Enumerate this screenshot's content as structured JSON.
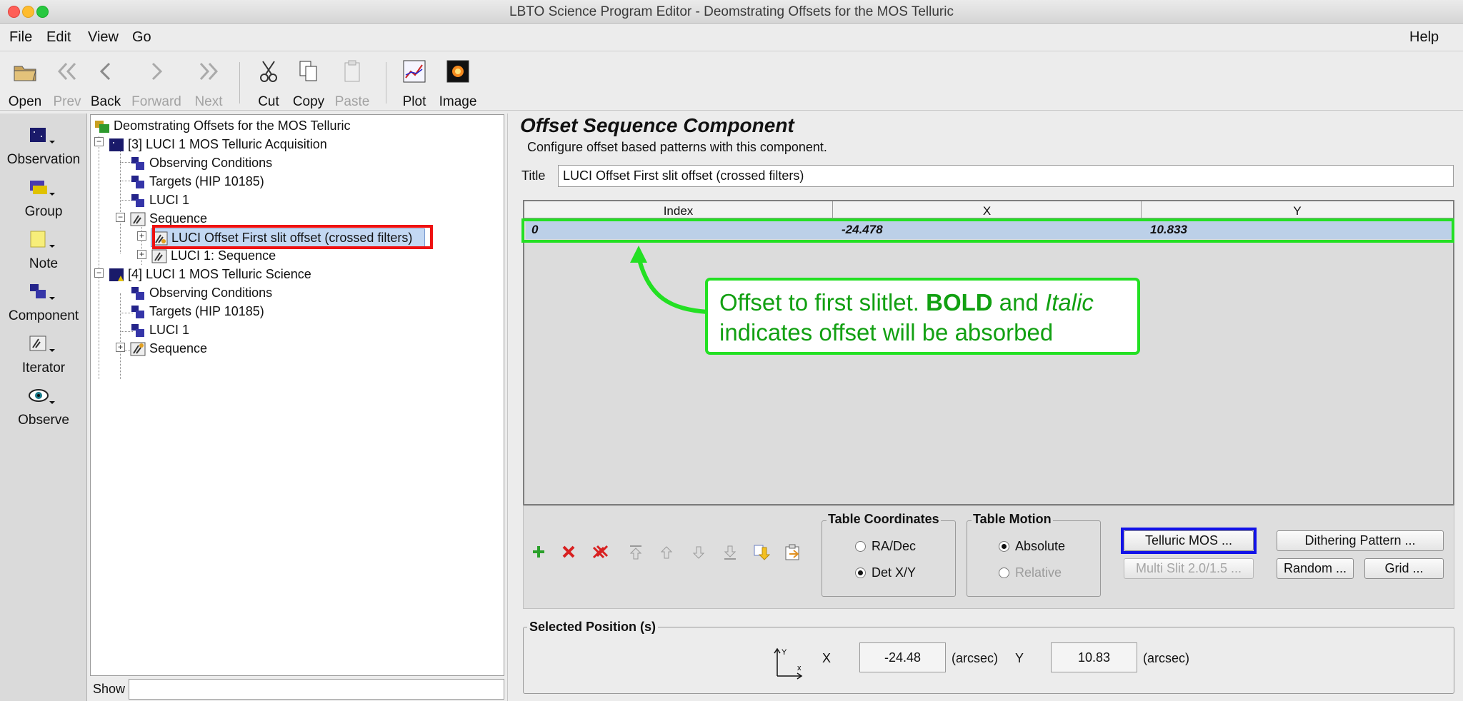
{
  "window": {
    "title": "LBTO Science Program Editor - Deomstrating Offsets for the MOS Telluric"
  },
  "menu": {
    "file": "File",
    "edit": "Edit",
    "view": "View",
    "go": "Go",
    "help": "Help"
  },
  "toolbar": {
    "open": "Open",
    "prev": "Prev",
    "back": "Back",
    "forward": "Forward",
    "next": "Next",
    "cut": "Cut",
    "copy": "Copy",
    "paste": "Paste",
    "plot": "Plot",
    "image": "Image"
  },
  "palette": {
    "observation": "Observation",
    "group": "Group",
    "note": "Note",
    "component": "Component",
    "iterator": "Iterator",
    "observe": "Observe"
  },
  "tree": {
    "root": "Deomstrating Offsets for the MOS Telluric",
    "acq": "[3] LUCI 1 MOS Telluric Acquisition",
    "acq_cond": "Observing Conditions",
    "acq_targets": "Targets (HIP 10185)",
    "acq_luci": "LUCI 1",
    "acq_seq": "Sequence",
    "acq_offset": "LUCI Offset First slit offset (crossed filters)",
    "acq_luciseq": "LUCI 1: Sequence",
    "sci": "[4] LUCI 1 MOS Telluric Science",
    "sci_cond": "Observing Conditions",
    "sci_targets": "Targets (HIP 10185)",
    "sci_luci": "LUCI 1",
    "sci_seq": "Sequence"
  },
  "show": {
    "label": "Show"
  },
  "component": {
    "heading": "Offset Sequence Component",
    "description": "Configure offset based patterns with this component.",
    "title_label": "Title",
    "title_value": "LUCI Offset First slit offset (crossed filters)"
  },
  "table": {
    "headers": [
      "Index",
      "X",
      "Y"
    ],
    "rows": [
      [
        "0",
        "-24.478",
        "10.833"
      ]
    ]
  },
  "annotation": {
    "part1": "Offset to first slitlet.  ",
    "bold": "BOLD",
    "part2": " and ",
    "italic": "Italic",
    "line2": "indicates offset will be absorbed"
  },
  "coords": {
    "title": "Table Coordinates",
    "radec": "RA/Dec",
    "detxy": "Det X/Y",
    "selected": "Det X/Y"
  },
  "motion": {
    "title": "Table Motion",
    "absolute": "Absolute",
    "relative": "Relative",
    "selected": "Absolute"
  },
  "buttons": {
    "telluric": "Telluric MOS ...",
    "multislit": "Multi Slit 2.0/1.5 ...",
    "dithering": "Dithering Pattern ...",
    "random": "Random ...",
    "grid": "Grid ..."
  },
  "selected_position": {
    "title": "Selected Position (s)",
    "x_label": "X",
    "x_value": "-24.48",
    "x_unit": "(arcsec)",
    "y_label": "Y",
    "y_value": "10.83",
    "y_unit": "(arcsec)",
    "axis_y": "Y",
    "axis_x": "x"
  },
  "colors": {
    "highlight_red": "#ee1111",
    "highlight_green": "#23e023",
    "highlight_blue": "#1212e8",
    "annotation_text": "#12a012"
  }
}
